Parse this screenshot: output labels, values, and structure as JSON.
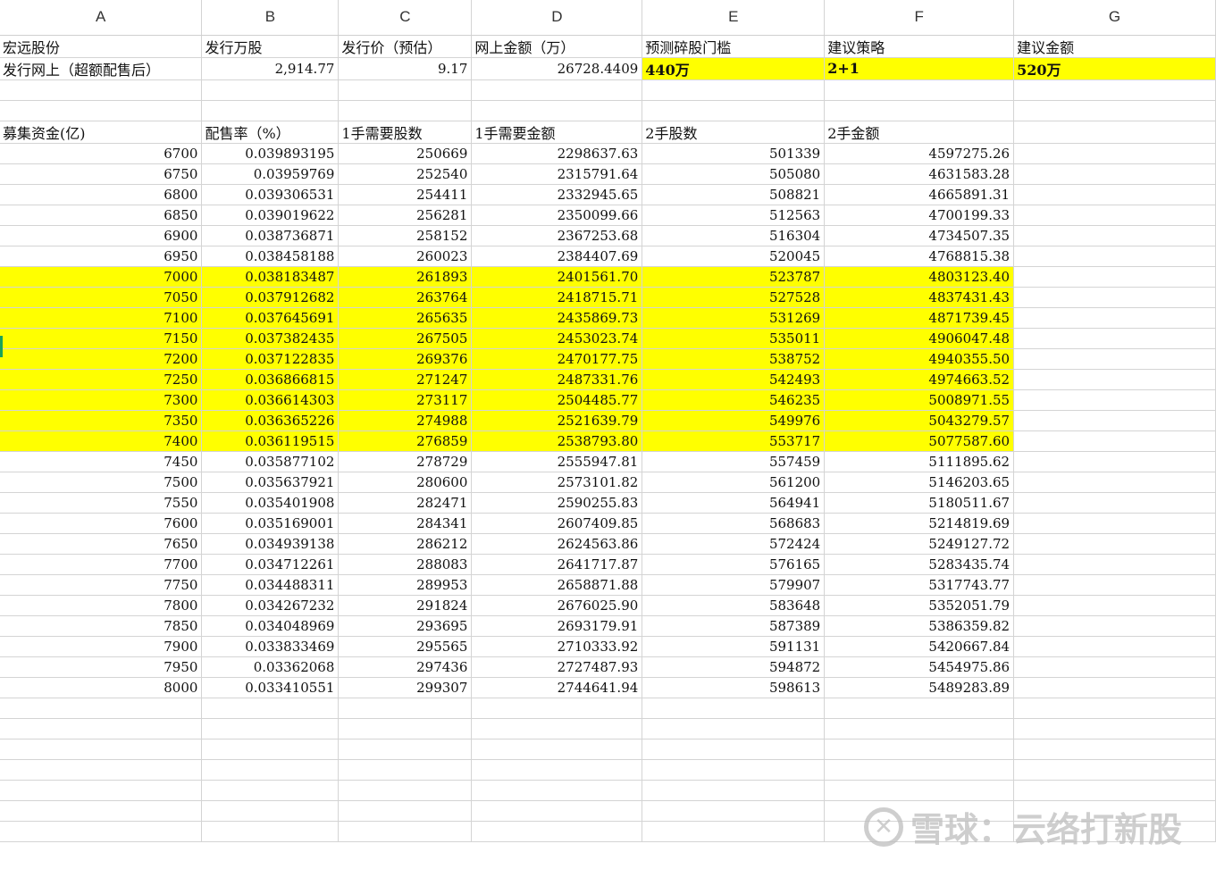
{
  "columns": [
    "A",
    "B",
    "C",
    "D",
    "E",
    "F",
    "G"
  ],
  "info_header": [
    "宏远股份",
    "发行万股",
    "发行价（预估）",
    "网上金额（万）",
    "预测碎股门槛",
    "建议策略",
    "建议金额"
  ],
  "info_values": [
    "发行网上（超额配售后）",
    "2,914.77",
    "9.17",
    "26728.4409",
    "440万",
    "2+1",
    "520万"
  ],
  "table_header": [
    "募集资金(亿)",
    "配售率（%）",
    "1手需要股数",
    "1手需要金额",
    "2手股数",
    "2手金额"
  ],
  "rows": [
    [
      "6700",
      "0.039893195",
      "250669",
      "2298637.63",
      "501339",
      "4597275.26"
    ],
    [
      "6750",
      "0.03959769",
      "252540",
      "2315791.64",
      "505080",
      "4631583.28"
    ],
    [
      "6800",
      "0.039306531",
      "254411",
      "2332945.65",
      "508821",
      "4665891.31"
    ],
    [
      "6850",
      "0.039019622",
      "256281",
      "2350099.66",
      "512563",
      "4700199.33"
    ],
    [
      "6900",
      "0.038736871",
      "258152",
      "2367253.68",
      "516304",
      "4734507.35"
    ],
    [
      "6950",
      "0.038458188",
      "260023",
      "2384407.69",
      "520045",
      "4768815.38"
    ],
    [
      "7000",
      "0.038183487",
      "261893",
      "2401561.70",
      "523787",
      "4803123.40"
    ],
    [
      "7050",
      "0.037912682",
      "263764",
      "2418715.71",
      "527528",
      "4837431.43"
    ],
    [
      "7100",
      "0.037645691",
      "265635",
      "2435869.73",
      "531269",
      "4871739.45"
    ],
    [
      "7150",
      "0.037382435",
      "267505",
      "2453023.74",
      "535011",
      "4906047.48"
    ],
    [
      "7200",
      "0.037122835",
      "269376",
      "2470177.75",
      "538752",
      "4940355.50"
    ],
    [
      "7250",
      "0.036866815",
      "271247",
      "2487331.76",
      "542493",
      "4974663.52"
    ],
    [
      "7300",
      "0.036614303",
      "273117",
      "2504485.77",
      "546235",
      "5008971.55"
    ],
    [
      "7350",
      "0.036365226",
      "274988",
      "2521639.79",
      "549976",
      "5043279.57"
    ],
    [
      "7400",
      "0.036119515",
      "276859",
      "2538793.80",
      "553717",
      "5077587.60"
    ],
    [
      "7450",
      "0.035877102",
      "278729",
      "2555947.81",
      "557459",
      "5111895.62"
    ],
    [
      "7500",
      "0.035637921",
      "280600",
      "2573101.82",
      "561200",
      "5146203.65"
    ],
    [
      "7550",
      "0.035401908",
      "282471",
      "2590255.83",
      "564941",
      "5180511.67"
    ],
    [
      "7600",
      "0.035169001",
      "284341",
      "2607409.85",
      "568683",
      "5214819.69"
    ],
    [
      "7650",
      "0.034939138",
      "286212",
      "2624563.86",
      "572424",
      "5249127.72"
    ],
    [
      "7700",
      "0.034712261",
      "288083",
      "2641717.87",
      "576165",
      "5283435.74"
    ],
    [
      "7750",
      "0.034488311",
      "289953",
      "2658871.88",
      "579907",
      "5317743.77"
    ],
    [
      "7800",
      "0.034267232",
      "291824",
      "2676025.90",
      "583648",
      "5352051.79"
    ],
    [
      "7850",
      "0.034048969",
      "293695",
      "2693179.91",
      "587389",
      "5386359.82"
    ],
    [
      "7900",
      "0.033833469",
      "295565",
      "2710333.92",
      "591131",
      "5420667.84"
    ],
    [
      "7950",
      "0.03362068",
      "297436",
      "2727487.93",
      "594872",
      "5454975.86"
    ],
    [
      "8000",
      "0.033410551",
      "299307",
      "2744641.94",
      "598613",
      "5489283.89"
    ]
  ],
  "highlight_range": [
    "7000",
    "7400"
  ],
  "highlight_color": "#ffff00",
  "empty_rows_after": 7,
  "watermark": {
    "icon": "xueqiu-logo-icon",
    "text": "雪球：云络打新股"
  }
}
